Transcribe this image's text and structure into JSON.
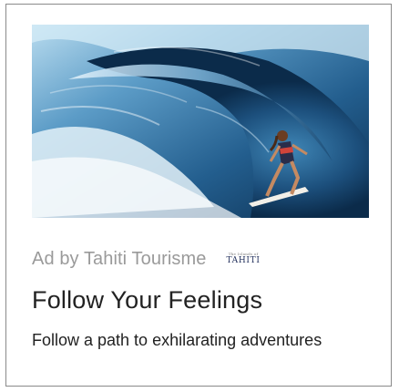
{
  "ad": {
    "sponsor_label": "Ad by Tahiti Tourisme",
    "brand_logo_small": "The Islands of",
    "brand_logo_main": "TAHITI",
    "headline": "Follow Your Feelings",
    "description": "Follow a path to exhilarating adventures",
    "image_icon": "surfer-in-wave-barrel-photo"
  },
  "colors": {
    "sponsor_text": "#9a9a9a",
    "headline_text": "#222222",
    "card_border": "#8a8a8a",
    "logo_navy": "#1f2d5a"
  }
}
